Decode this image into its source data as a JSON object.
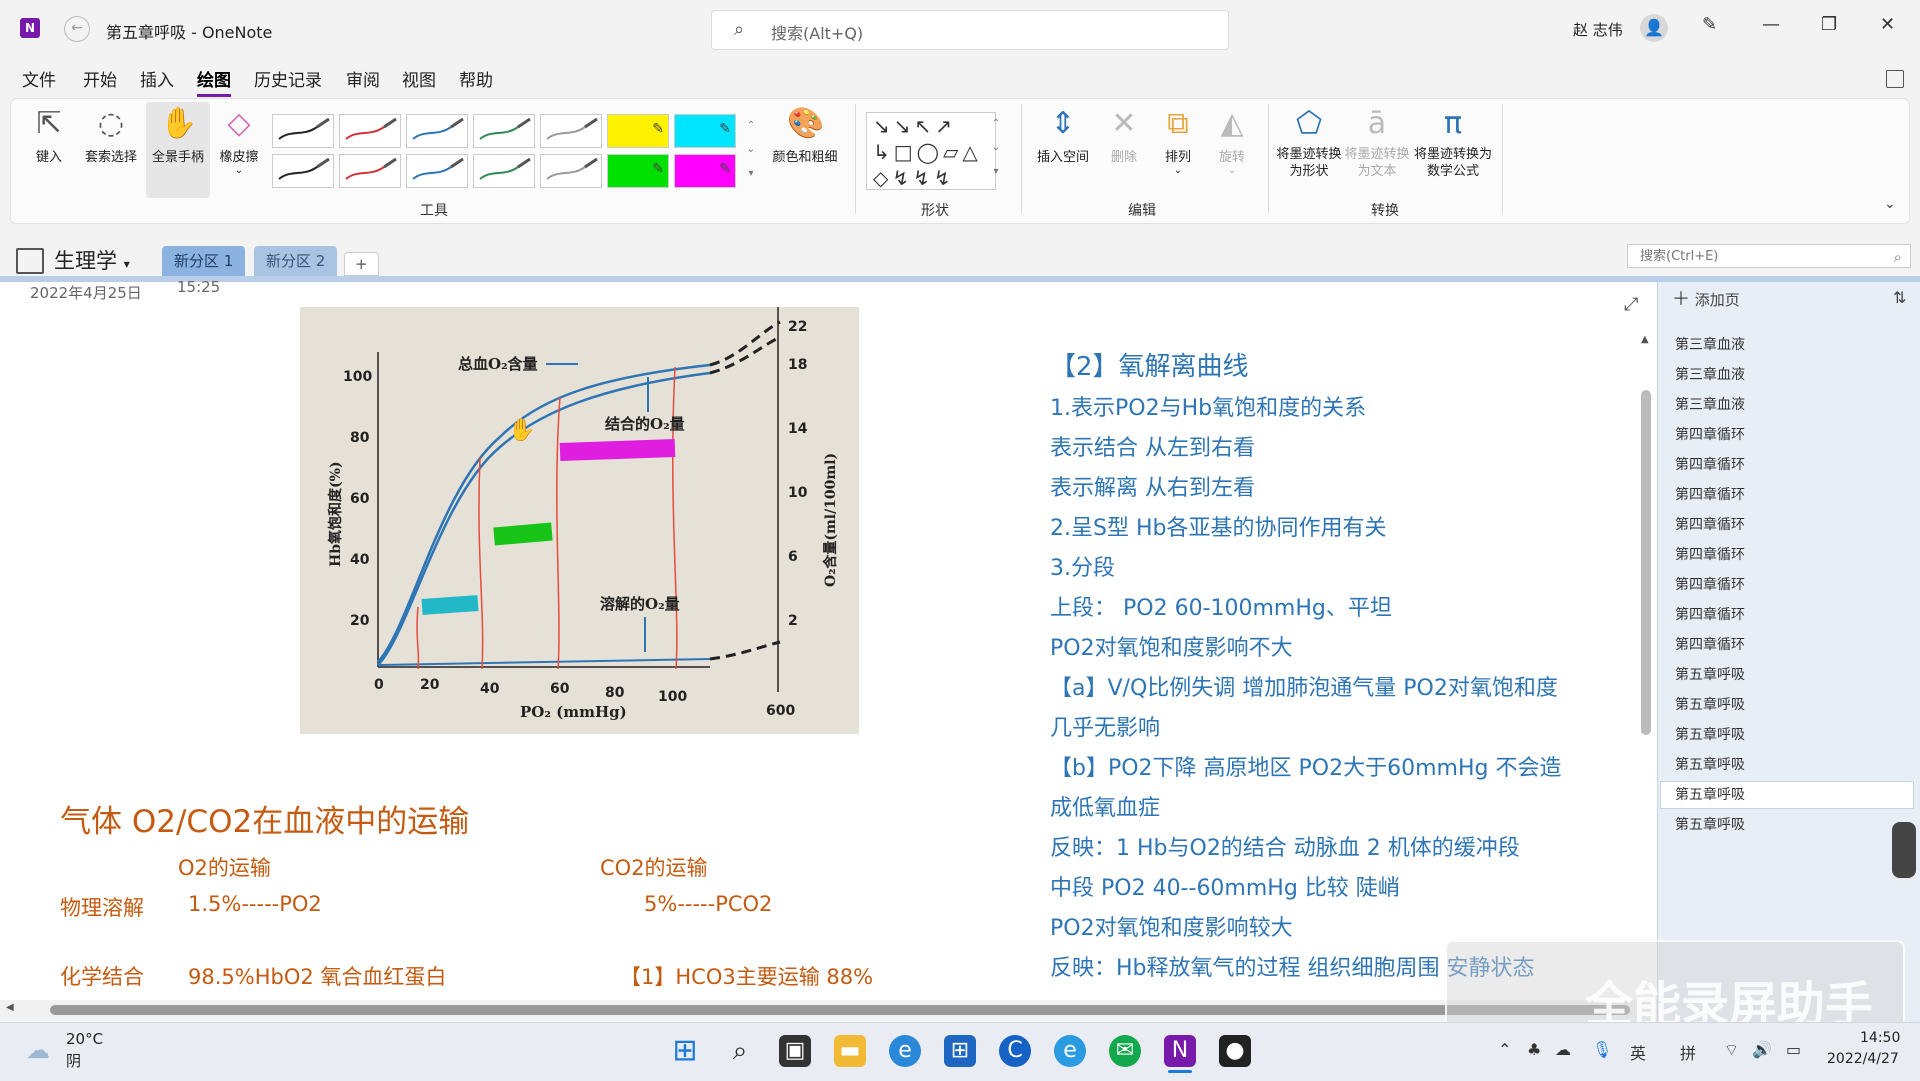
{
  "titlebar": {
    "app_icon_letter": "N",
    "doc_title": "第五章呼吸  -  OneNote",
    "search_placeholder": "搜索(Alt+Q)",
    "user_name": "赵 志伟"
  },
  "menu": [
    "文件",
    "开始",
    "插入",
    "绘图",
    "历史记录",
    "审阅",
    "视图",
    "帮助"
  ],
  "ribbon": {
    "tools": [
      "键入",
      "套索选择",
      "全景手柄",
      "橡皮擦"
    ],
    "colors_label": "颜色和粗细",
    "group_tools": "工具",
    "group_shapes": "形状",
    "edit": [
      "插入空间",
      "删除",
      "排列",
      "旋转"
    ],
    "group_edit": "编辑",
    "convert": [
      "将墨迹转换为形状",
      "将墨迹转换为文本",
      "将墨迹转换为数学公式"
    ],
    "group_convert": "转换",
    "pen_colors": [
      "#222222",
      "#d13438",
      "#2e75b6",
      "#2e8b57",
      "#999999",
      "#fff200",
      "#00e5ff",
      "#222222",
      "#d13438",
      "#2e75b6",
      "#2e8b57",
      "#999999",
      "#00e000",
      "#ff00ff"
    ]
  },
  "notebook": {
    "name": "生理学",
    "sections": [
      "新分区 1",
      "新分区 2"
    ],
    "add_section": "+",
    "page_search_placeholder": "搜索(Ctrl+E)"
  },
  "page": {
    "date": "2022年4月25日",
    "time": "15:25",
    "right_notes": [
      "【2】氧解离曲线",
      "1.表示PO2与Hb氧饱和度的关系",
      "表示结合  从左到右看",
      "表示解离    从右到左看",
      "2.呈S型    Hb各亚基的协同作用有关",
      "3.分段",
      "上段：  PO2   60-100mmHg、平坦",
      "PO2对氧饱和度影响不大",
      "【a】V/Q比例失调 增加肺泡通气量 PO2对氧饱和度",
      "几乎无影响",
      "【b】PO2下降 高原地区   PO2大于60mmHg 不会造",
      "成低氧血症",
      "反映：1   Hb与O2的结合 动脉血 2 机体的缓冲段",
      "中段   PO2   40--60mmHg      比较 陡峭",
      "PO2对氧饱和度影响较大",
      "反映：Hb释放氧气的过程   组织细胞周围   安静状态"
    ],
    "left_heading": "气体 O2/CO2在血液中的运输",
    "o2_header": "O2的运输",
    "co2_header": "CO2的运输",
    "row1_label": "物理溶解",
    "row1_o2": "1.5%-----PO2",
    "row1_co2": "5%-----PCO2",
    "row2_label": "化学结合",
    "row2_o2": "98.5%HbO2 氧合血红蛋白",
    "row2_co2": "【1】HCO3主要运输   88%"
  },
  "figure": {
    "label_total": "总血O₂含量",
    "label_bound": "结合的O₂量",
    "label_dissolved": "溶解的O₂量",
    "left_axis_title": "Hb氧饱和度(%)",
    "right_axis_title": "O₂含量(ml/100ml)",
    "x_axis_title": "PO₂ (mmHg)",
    "x_ticks": [
      "0",
      "20",
      "40",
      "60",
      "80",
      "100",
      "600"
    ],
    "y_left_ticks": [
      "20",
      "40",
      "60",
      "80",
      "100"
    ],
    "y_right_ticks": [
      "2",
      "6",
      "10",
      "14",
      "18",
      "22"
    ]
  },
  "pages_pane": {
    "add_page": "添加页",
    "pages": [
      "第三章血液",
      "第三章血液",
      "第三章血液",
      "第四章循环",
      "第四章循环",
      "第四章循环",
      "第四章循环",
      "第四章循环",
      "第四章循环",
      "第四章循环",
      "第四章循环",
      "第五章呼吸",
      "第五章呼吸",
      "第五章呼吸",
      "第五章呼吸",
      "第五章呼吸",
      "第五章呼吸"
    ],
    "active_index": 15
  },
  "taskbar": {
    "weather_temp": "20°C",
    "weather_cond": "阴",
    "tray_lang": "英",
    "tray_ime": "拼",
    "time": "14:50",
    "date": "2022/4/27"
  },
  "watermark": "全能录屏助手"
}
